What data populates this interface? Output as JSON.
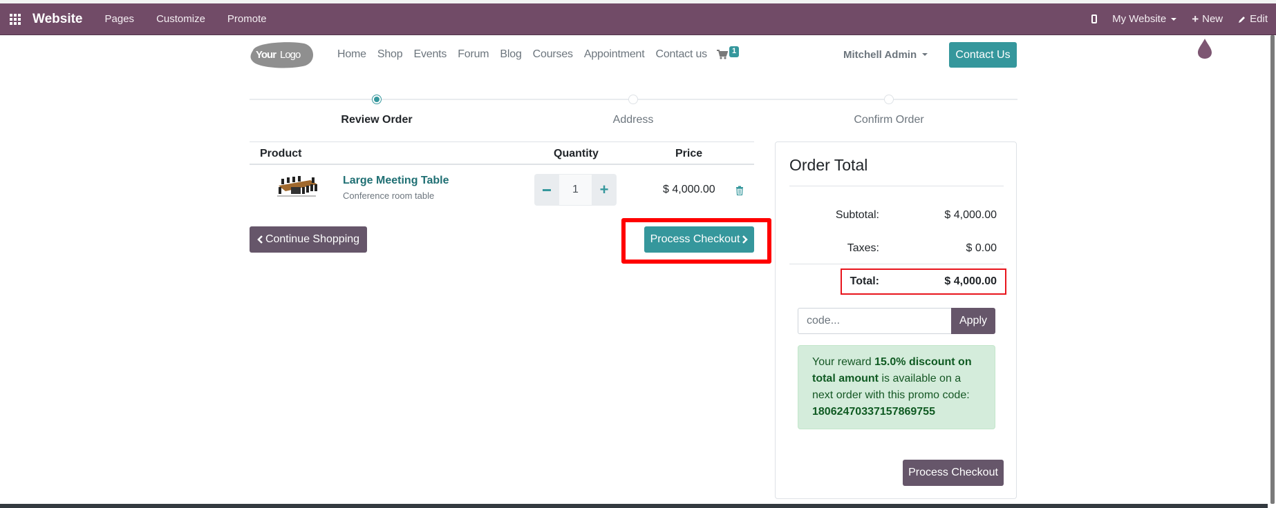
{
  "navbar": {
    "brand": "Website",
    "menu": [
      "Pages",
      "Customize",
      "Promote"
    ],
    "right": {
      "website_selector": "My Website",
      "new_label": "New",
      "edit_label": "Edit"
    },
    "colors": {
      "background": "#714b67"
    }
  },
  "header": {
    "logo_text": "YourLogo",
    "nav_links": [
      "Home",
      "Shop",
      "Events",
      "Forum",
      "Blog",
      "Courses",
      "Appointment",
      "Contact us"
    ],
    "cart_count": "1",
    "user_name": "Mitchell Admin",
    "contact_button": "Contact Us"
  },
  "wizard": {
    "steps": [
      {
        "label": "Review Order",
        "active": true
      },
      {
        "label": "Address",
        "active": false
      },
      {
        "label": "Confirm Order",
        "active": false
      }
    ]
  },
  "cart": {
    "columns": {
      "product": "Product",
      "quantity": "Quantity",
      "price": "Price"
    },
    "items": [
      {
        "name": "Large Meeting Table",
        "description": "Conference room table",
        "quantity": "1",
        "price": "$ 4,000.00"
      }
    ],
    "continue_label": "Continue Shopping",
    "process_label": "Process Checkout"
  },
  "summary": {
    "title": "Order Total",
    "subtotal_label": "Subtotal:",
    "subtotal_value": "$ 4,000.00",
    "taxes_label": "Taxes:",
    "taxes_value": "$ 0.00",
    "total_label": "Total:",
    "total_value": "$ 4,000.00",
    "promo_placeholder": "code...",
    "apply_label": "Apply",
    "reward": {
      "prefix": "Your reward ",
      "bold": "15.0% discount on total amount",
      "middle": " is available on a next order with this promo code: ",
      "code": "18062470337157869755"
    },
    "process_label": "Process Checkout"
  },
  "colors": {
    "primary": "#35979c",
    "secondary": "#66566a",
    "highlight": "#ff0000"
  }
}
